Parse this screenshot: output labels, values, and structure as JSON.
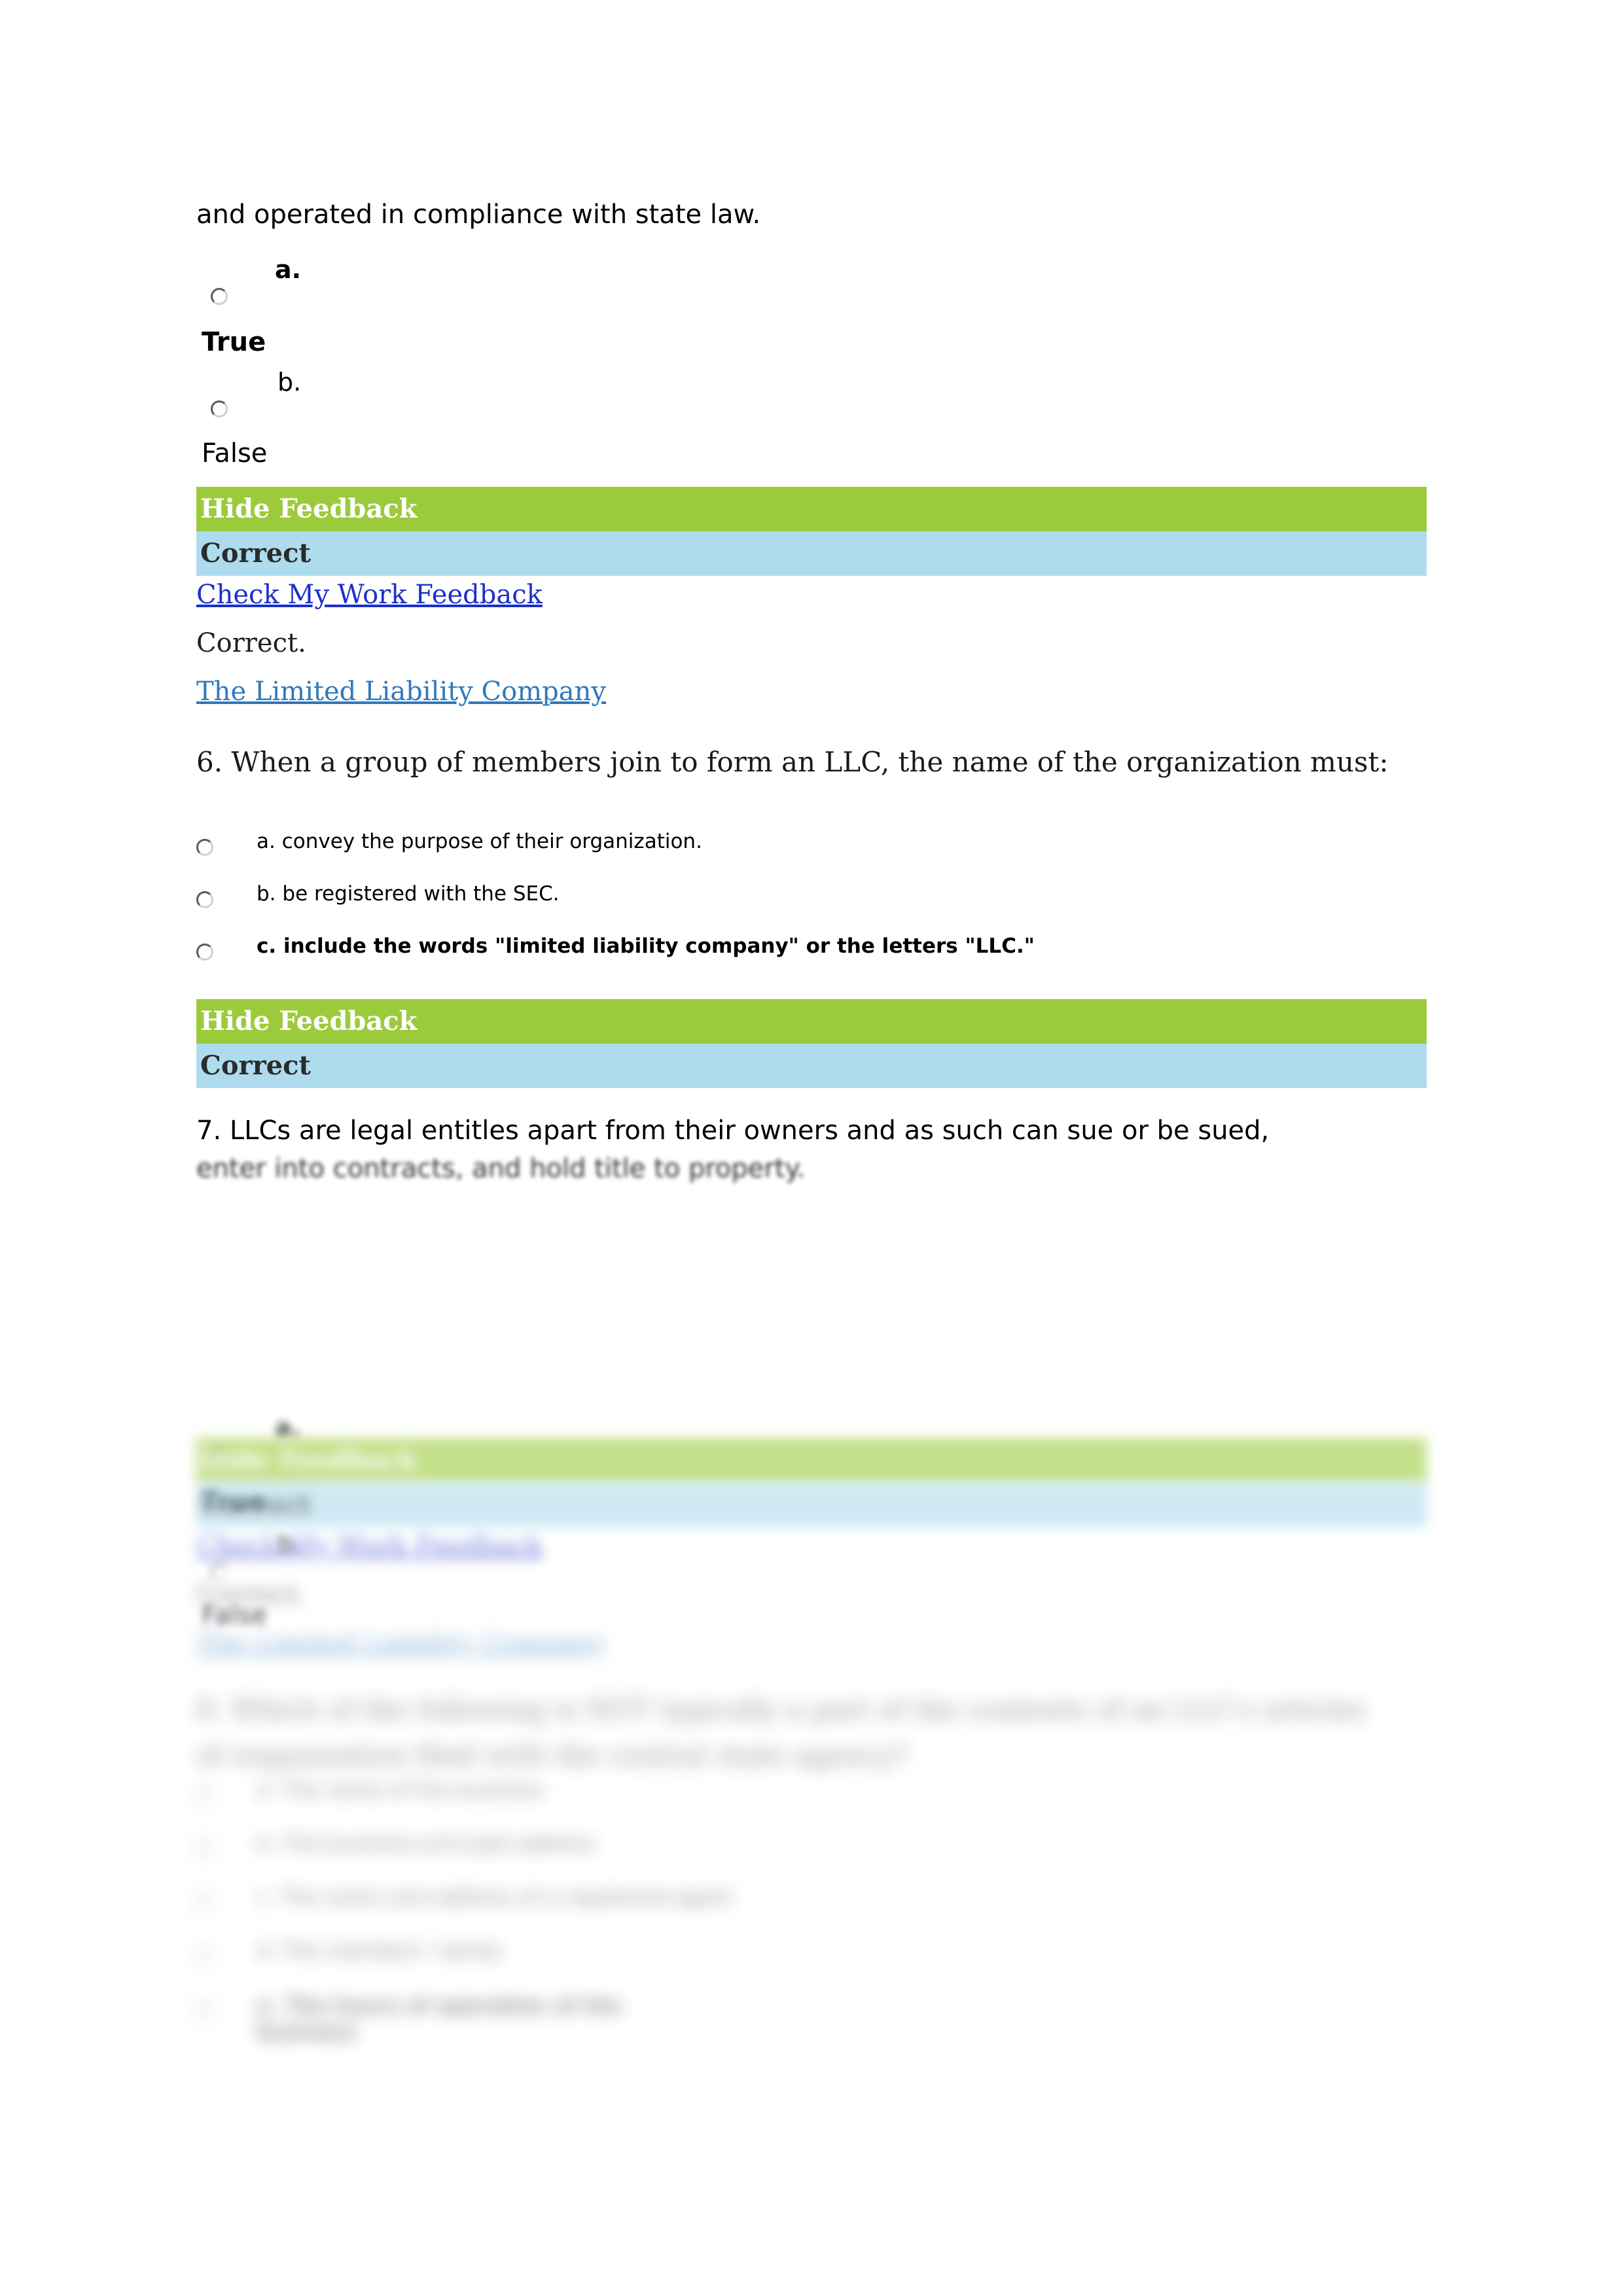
{
  "document": {
    "type": "quiz-feedback-page",
    "colors": {
      "feedback_header_green": "#9bcb3b",
      "feedback_status_blue": "#aedcee",
      "link_blue_strong": "#1b31c9",
      "link_blue_soft": "#2f79bd",
      "page_background": "#ffffff"
    }
  },
  "q5": {
    "stem_continuation": "and operated in compliance with state law.",
    "options": [
      {
        "letter": "a.",
        "label": "True",
        "bold": true,
        "selected": false
      },
      {
        "letter": "b.",
        "label": "False",
        "bold": false,
        "selected": false
      }
    ],
    "feedback": {
      "hide_label": "Hide Feedback",
      "status": "Correct",
      "check_my_work_link": "Check My Work Feedback",
      "body": "Correct.",
      "reference_link": "The Limited Liability Company"
    }
  },
  "q6": {
    "stem": "6. When a group of members join to form an LLC, the name of the organization must:",
    "options": [
      {
        "text": "a. convey the purpose of their organization.",
        "bold": false,
        "selected": false
      },
      {
        "text": "b. be registered with the SEC.",
        "bold": false,
        "selected": false
      },
      {
        "text": "c. include the words \"limited liability company\" or the letters \"LLC.\"",
        "bold": true,
        "selected": false
      }
    ],
    "feedback": {
      "hide_label": "Hide Feedback",
      "status": "Correct"
    }
  },
  "q7": {
    "stem_line1": "7. LLCs are legal entitles apart from their owners and as such can sue or be sued,",
    "stem_line2": "enter into contracts, and hold title to property.",
    "options": [
      {
        "letter": "a.",
        "label": "True",
        "bold": true,
        "selected": false
      },
      {
        "letter": "b.",
        "label": "False",
        "bold": false,
        "selected": false
      }
    ],
    "feedback": {
      "hide_label": "Hide Feedback",
      "status": "Correct",
      "check_my_work_link": "Check My Work Feedback",
      "body": "Correct.",
      "reference_link": "The Limited Liability Company"
    }
  },
  "q8": {
    "stem_line1": "8. Which of the following is NOT typically a part of the contents of an LLC's articles",
    "stem_line2": "of organization filed with the central state agency?",
    "options": [
      {
        "text": "a. The name of the business",
        "bold": false,
        "selected": false
      },
      {
        "text": "b. The business principal address",
        "bold": false,
        "selected": false
      },
      {
        "text": "c. The name and address of a registered agent",
        "bold": false,
        "selected": false
      },
      {
        "text": "d. The members' names",
        "bold": false,
        "selected": false
      },
      {
        "text": "e. The hours of operation of the business",
        "bold": true,
        "selected": false
      }
    ]
  }
}
